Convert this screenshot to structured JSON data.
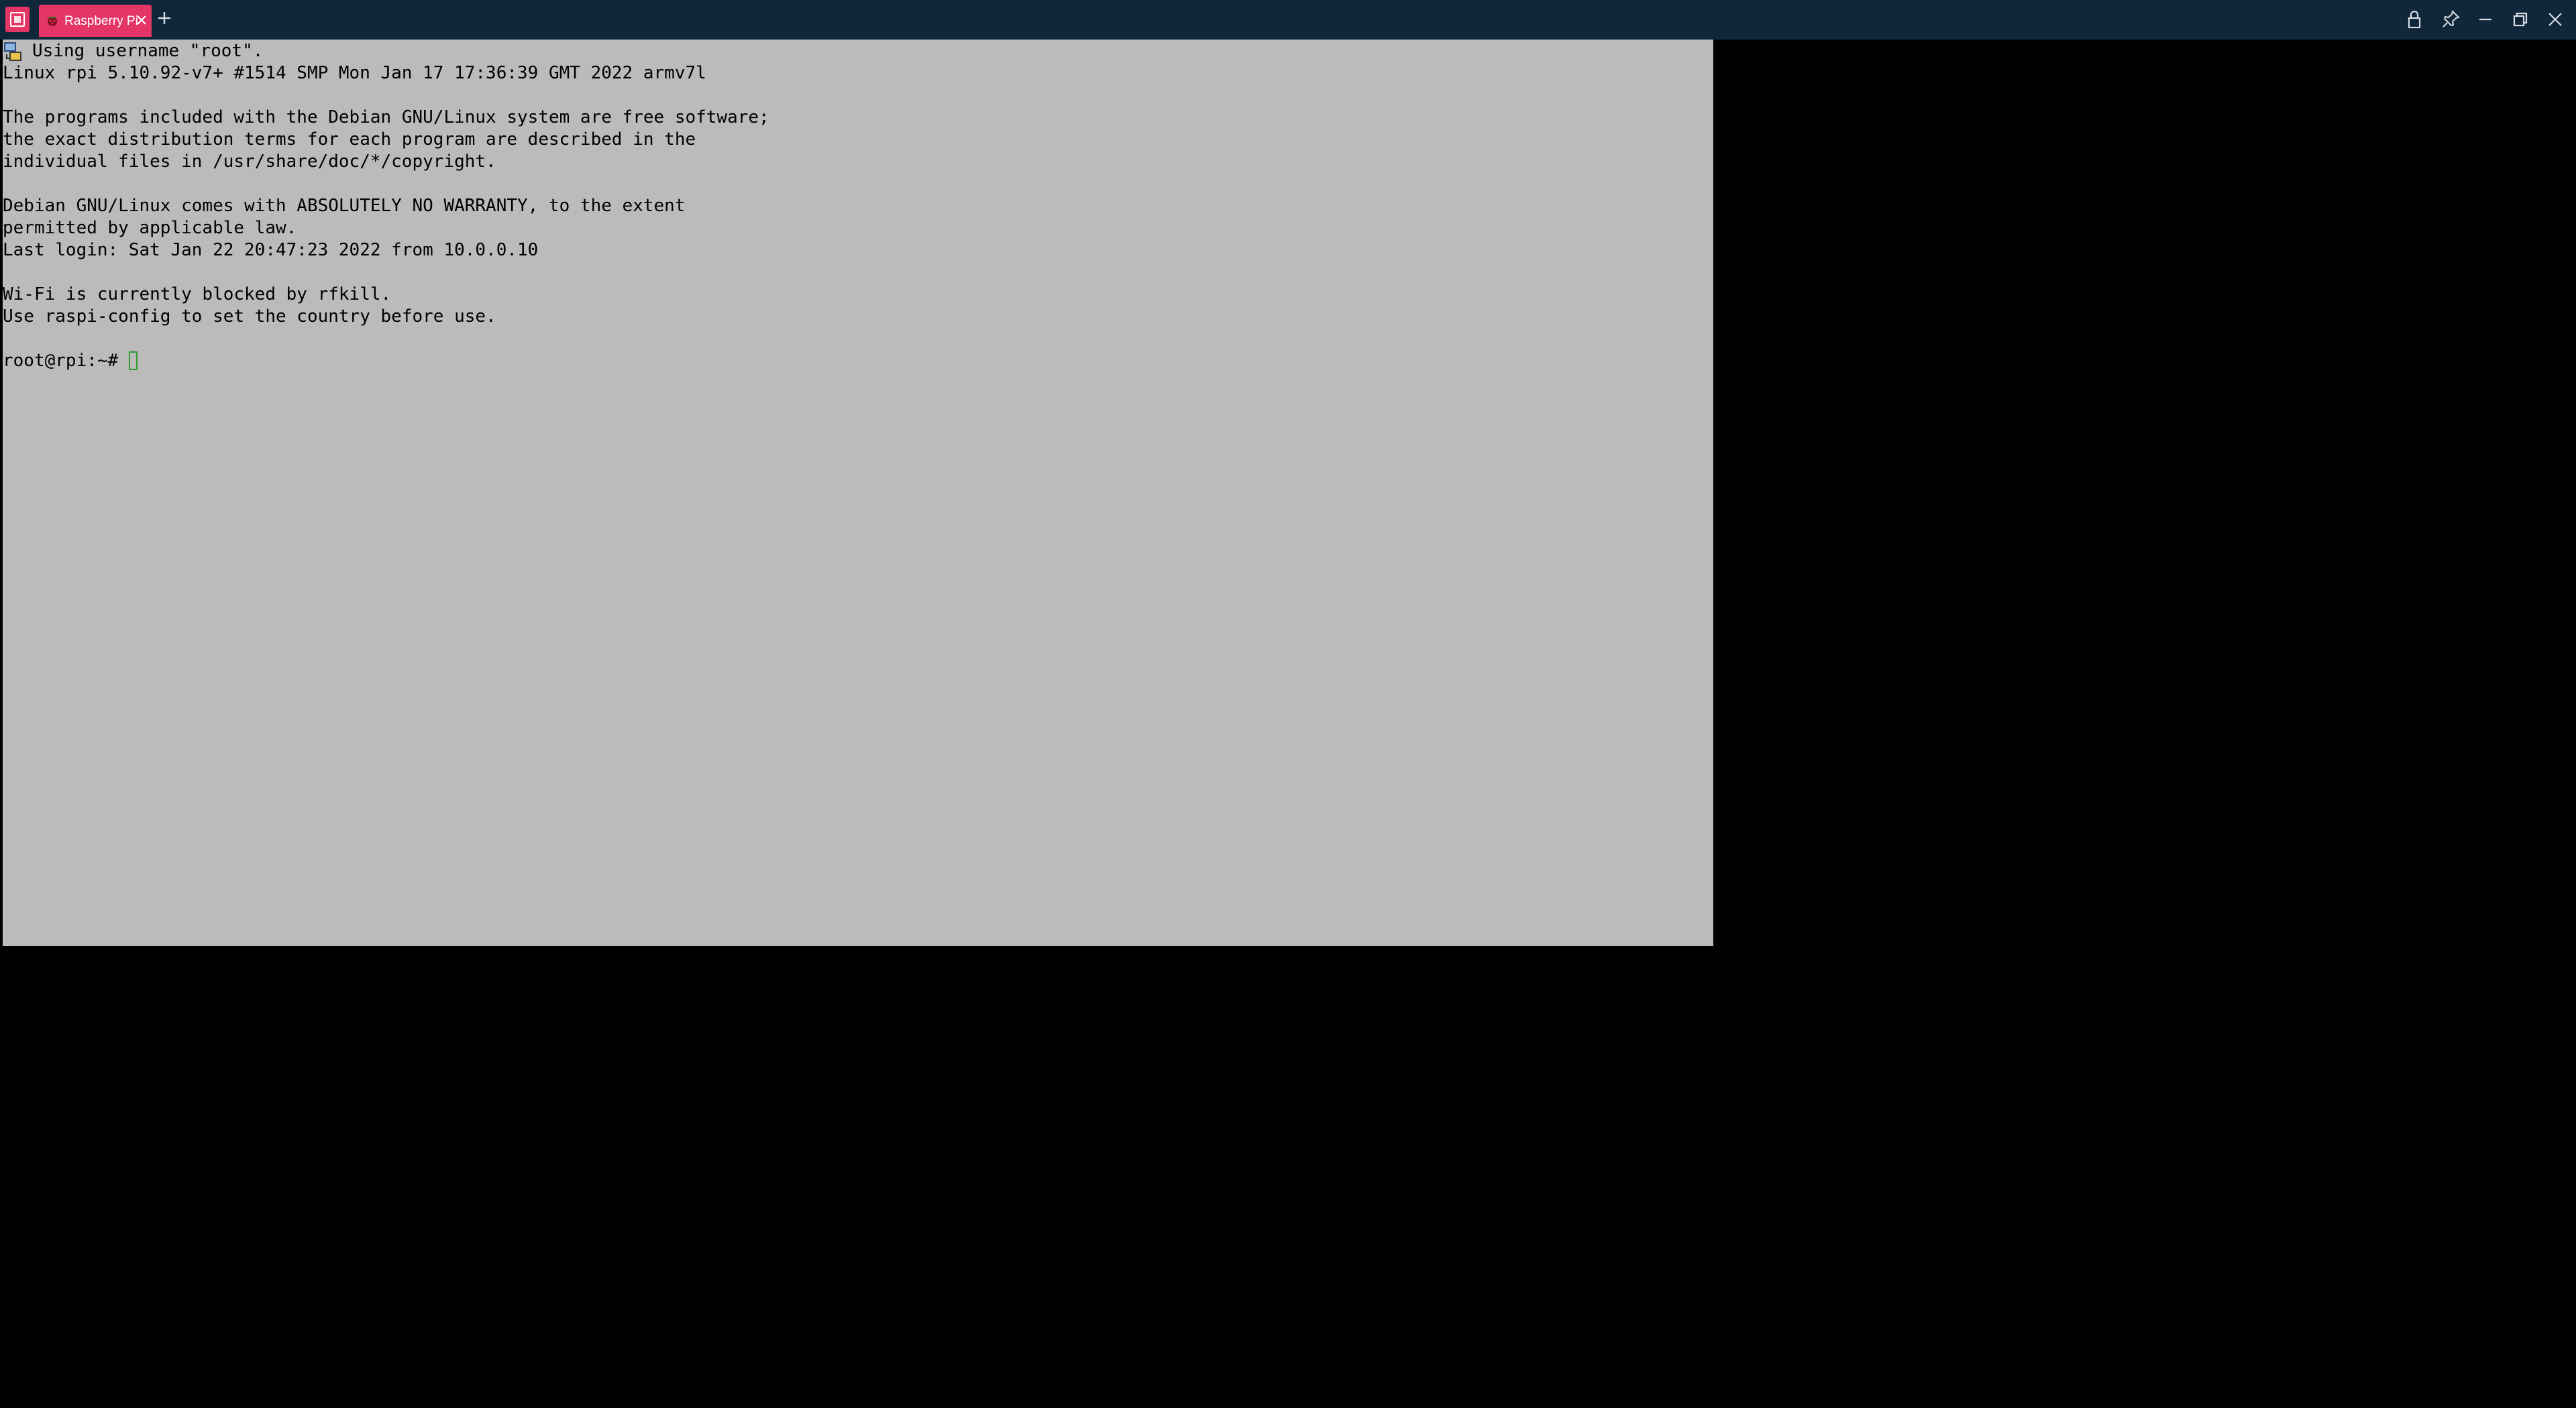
{
  "window": {
    "app_icon": "moba-terminal-logo-icon",
    "tabs": [
      {
        "label": "Raspberry Pi",
        "icon": "raspberry-pi-icon",
        "active": true
      }
    ],
    "controls": [
      "lock-icon",
      "pin-icon",
      "minimize-icon",
      "restore-icon",
      "close-icon"
    ]
  },
  "terminal": {
    "session_icon": "ssh-session-icon",
    "lines": [
      "Using username \"root\".",
      "Linux rpi 5.10.92-v7+ #1514 SMP Mon Jan 17 17:36:39 GMT 2022 armv7l",
      "",
      "The programs included with the Debian GNU/Linux system are free software;",
      "the exact distribution terms for each program are described in the",
      "individual files in /usr/share/doc/*/copyright.",
      "",
      "Debian GNU/Linux comes with ABSOLUTELY NO WARRANTY, to the extent",
      "permitted by applicable law.",
      "Last login: Sat Jan 22 20:47:23 2022 from 10.0.0.10",
      "",
      "Wi-Fi is currently blocked by rfkill.",
      "Use raspi-config to set the country before use.",
      ""
    ],
    "prompt": "root@rpi:~#"
  },
  "colors": {
    "titlebar": "#10263a",
    "tab_accent": "#e33667",
    "terminal_background": "#bbbbbb",
    "terminal_text": "#000000",
    "cursor": "#2f9c2f",
    "window_background": "#000000"
  }
}
